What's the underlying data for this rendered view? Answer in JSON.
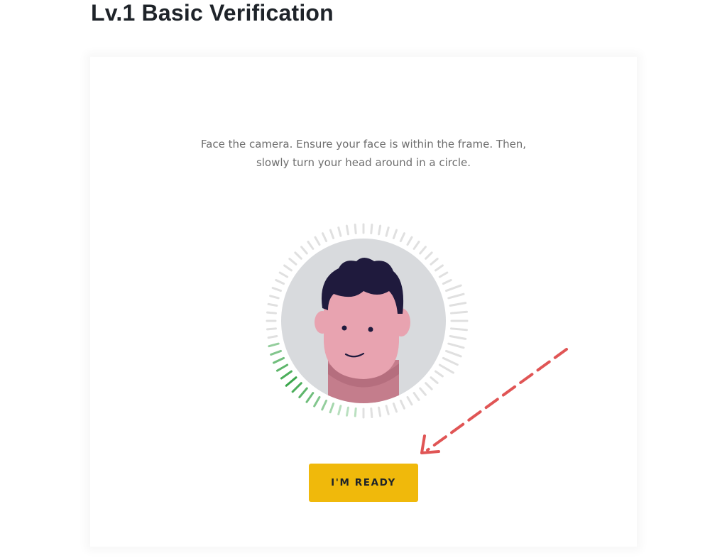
{
  "header": {
    "title": "Lv.1 Basic Verification"
  },
  "card": {
    "instruction_line1": "Face the camera. Ensure your face is within the frame. Then,",
    "instruction_line2": "slowly turn your head around in a circle.",
    "ready_button_label": "I'M READY"
  },
  "colors": {
    "accent": "#f0b90b",
    "progress_green": "#3aa64b",
    "tick_gray": "#dddddd",
    "face_bg": "#d8dadd",
    "skin": "#e8a3b0",
    "hair": "#1f1a3d",
    "annotation_arrow": "#e05555"
  },
  "icons": {
    "avatar": "face-scan-illustration",
    "arrow": "dashed-pointer-arrow"
  }
}
